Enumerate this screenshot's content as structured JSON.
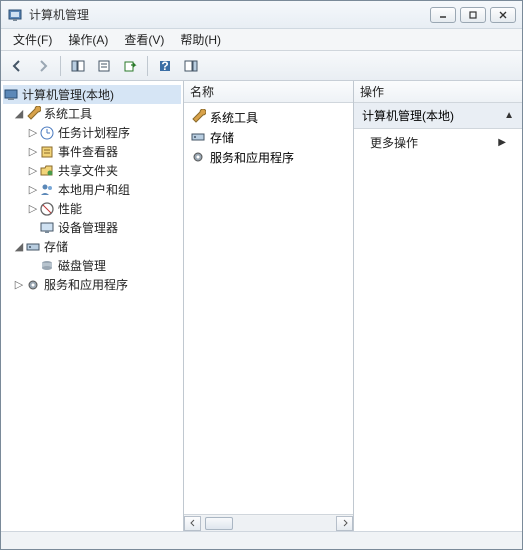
{
  "window": {
    "title": "计算机管理"
  },
  "menu": {
    "file": "文件(F)",
    "action": "操作(A)",
    "view": "查看(V)",
    "help": "帮助(H)"
  },
  "tree": {
    "root": "计算机管理(本地)",
    "system_tools": "系统工具",
    "task_scheduler": "任务计划程序",
    "event_viewer": "事件查看器",
    "shared_folders": "共享文件夹",
    "local_users": "本地用户和组",
    "performance": "性能",
    "device_manager": "设备管理器",
    "storage": "存储",
    "disk_mgmt": "磁盘管理",
    "services_apps": "服务和应用程序"
  },
  "list": {
    "header": "名称",
    "items": {
      "system_tools": "系统工具",
      "storage": "存储",
      "services_apps": "服务和应用程序"
    }
  },
  "actions": {
    "header": "操作",
    "context": "计算机管理(本地)",
    "more": "更多操作"
  }
}
